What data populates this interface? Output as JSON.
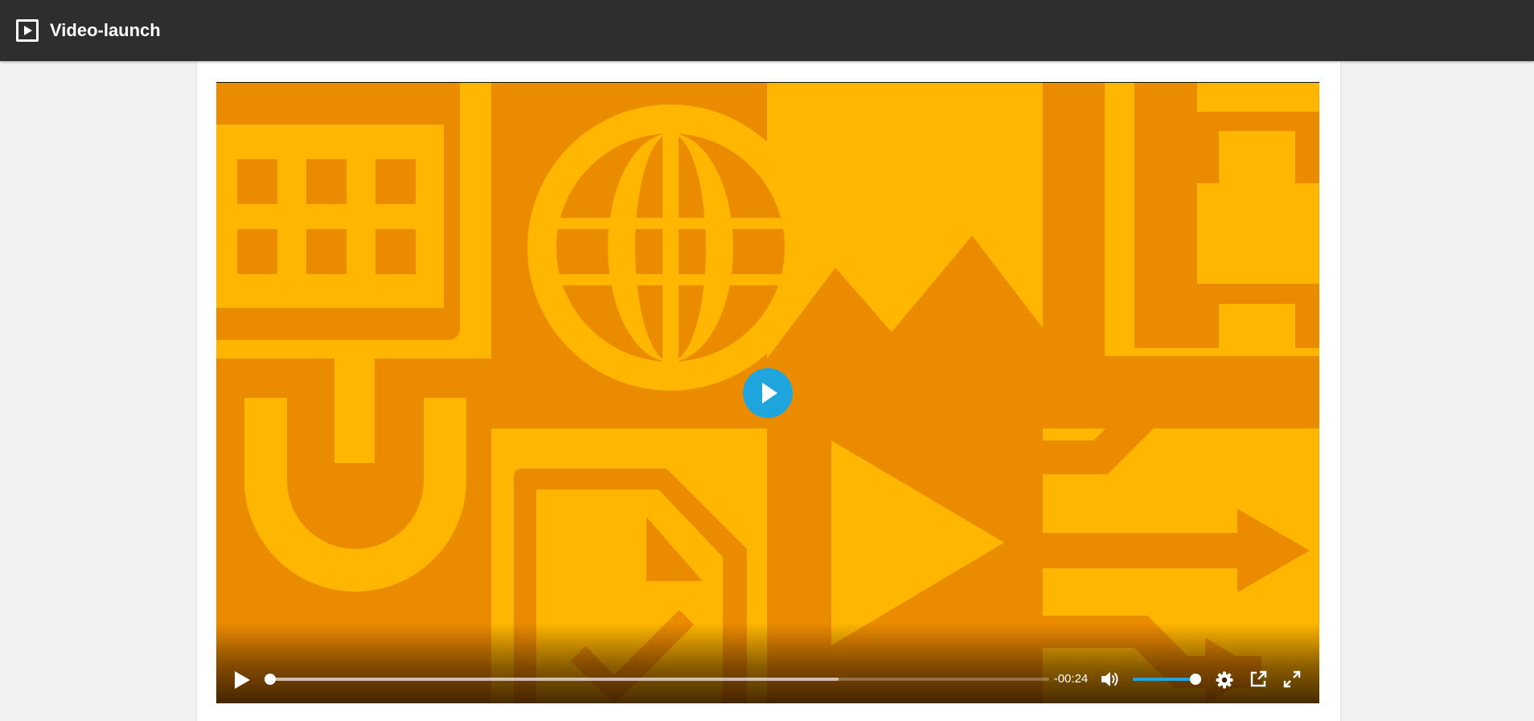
{
  "app": {
    "title": "Video-launch",
    "icon": "play-square-icon"
  },
  "player": {
    "current_time_remaining": "-00:24",
    "progress_fraction": 0.0,
    "buffered_fraction": 0.73,
    "volume_fraction": 1.0,
    "accent_color": "#1ea5dd",
    "poster_colors": {
      "light": "#ffb600",
      "dark": "#eb8b00"
    },
    "controls": {
      "play_icon": "play-icon",
      "volume_icon": "speaker-volume-icon",
      "settings_icon": "gear-icon",
      "popout_icon": "external-link-icon",
      "fullscreen_icon": "fullscreen-icon"
    }
  }
}
